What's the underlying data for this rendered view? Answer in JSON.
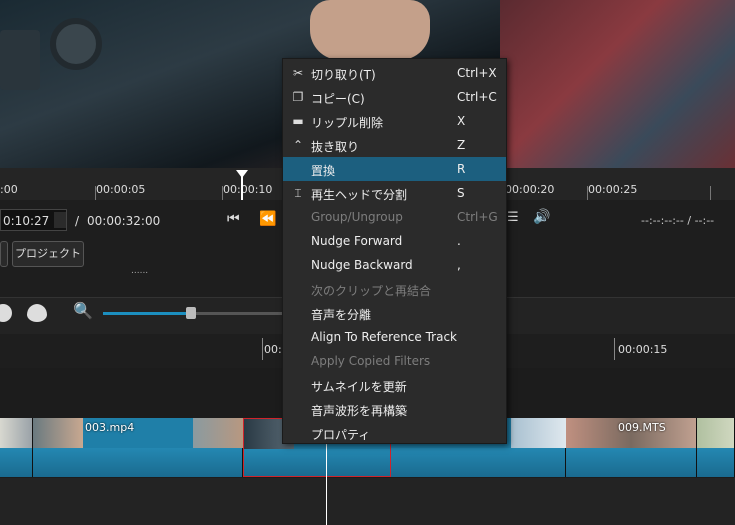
{
  "ruler": {
    "labels": [
      ":00",
      "00:00:05",
      "00:00:10",
      "00:00:15",
      "00:00:20",
      "00:00:25"
    ]
  },
  "timecode": {
    "current": "0:10:27",
    "separator": "/",
    "total": "00:00:32:00",
    "right_readout": "--:--:--:-- / --:--"
  },
  "buttons": {
    "project": "プロジェクト",
    "dots": "......"
  },
  "timeline": {
    "marker1": "00:",
    "marker2": "00:00:15"
  },
  "clips": [
    {
      "name": "003.mp4"
    },
    {
      "name": "009.MTS"
    }
  ],
  "menu": {
    "items": [
      {
        "icon": "scissors-icon",
        "label": "切り取り(T)",
        "shortcut": "Ctrl+X",
        "enabled": true
      },
      {
        "icon": "copy-icon",
        "label": "コピー(C)",
        "shortcut": "Ctrl+C",
        "enabled": true
      },
      {
        "icon": "minus-icon",
        "label": "リップル削除",
        "shortcut": "X",
        "enabled": true
      },
      {
        "icon": "caret-up-icon",
        "label": "抜き取り",
        "shortcut": "Z",
        "enabled": true
      },
      {
        "icon": "",
        "label": "置換",
        "shortcut": "R",
        "enabled": true,
        "selected": true
      },
      {
        "icon": "split-icon",
        "label": "再生ヘッドで分割",
        "shortcut": "S",
        "enabled": true
      },
      {
        "icon": "",
        "label": "Group/Ungroup",
        "shortcut": "Ctrl+G",
        "enabled": false
      },
      {
        "icon": "",
        "label": "Nudge Forward",
        "shortcut": ".",
        "enabled": true
      },
      {
        "icon": "",
        "label": "Nudge Backward",
        "shortcut": ",",
        "enabled": true
      },
      {
        "icon": "",
        "label": "次のクリップと再結合",
        "shortcut": "",
        "enabled": false
      },
      {
        "icon": "",
        "label": "音声を分離",
        "shortcut": "",
        "enabled": true
      },
      {
        "icon": "",
        "label": "Align To Reference Track",
        "shortcut": "",
        "enabled": true
      },
      {
        "icon": "",
        "label": "Apply Copied Filters",
        "shortcut": "",
        "enabled": false
      },
      {
        "icon": "",
        "label": "サムネイルを更新",
        "shortcut": "",
        "enabled": true
      },
      {
        "icon": "",
        "label": "音声波形を再構築",
        "shortcut": "",
        "enabled": true
      },
      {
        "icon": "",
        "label": "プロパティ",
        "shortcut": "",
        "enabled": true
      }
    ]
  },
  "colors": {
    "accent": "#1c5f7f",
    "clip": "#1f7fa8",
    "selection": "#d0242b"
  }
}
